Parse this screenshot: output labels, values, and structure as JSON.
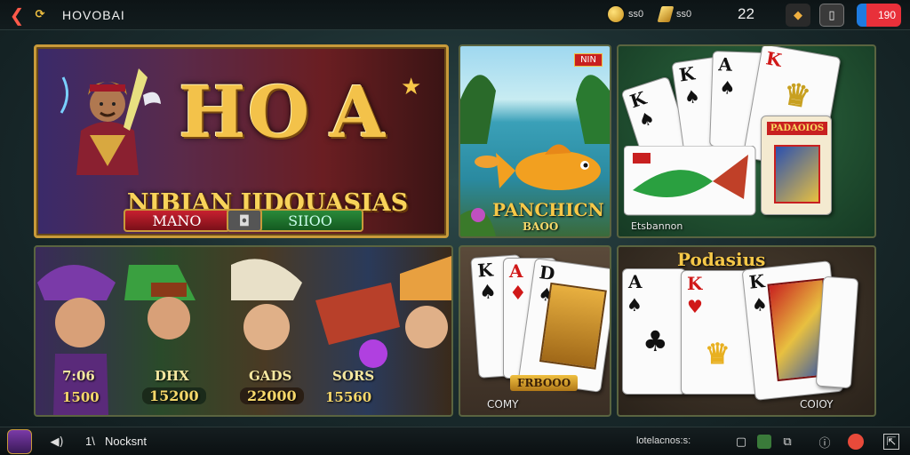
{
  "topbar": {
    "title": "HOVOBAI",
    "coins": "ss0",
    "gold": "ss0",
    "level": "22",
    "gem_value": "190"
  },
  "banner": {
    "title_left": "HO",
    "title_right": "A",
    "subtitle": "NIBIAN IIDOUASIAS",
    "button_left": "MANO",
    "button_right": "SIIOO"
  },
  "fish_game": {
    "badge": "NIN",
    "title": "PANCHICN",
    "sub": "BAOO"
  },
  "cards_game_1": {
    "banner": "PADAOIOS",
    "caption": "Etsbannon",
    "ranks": [
      "K",
      "K",
      "A",
      "K"
    ]
  },
  "slot_tiles": [
    {
      "name": "7:06",
      "value": "1500"
    },
    {
      "name": "DHX",
      "value": "15200"
    },
    {
      "name": "GADS",
      "value": "22000"
    },
    {
      "name": "SORS",
      "value": "15560"
    }
  ],
  "cards_game_2": {
    "ranks": [
      "K",
      "A",
      "D"
    ],
    "plate": "FRBOOO",
    "caption": "COMY"
  },
  "cards_game_3": {
    "title": "Podasius",
    "ranks": [
      "A",
      "K",
      "K"
    ],
    "caption": "COIOY"
  },
  "botbar": {
    "label_number": "1\\",
    "label": "Nocksnt",
    "right_text": "lotelacnos:s:"
  },
  "colors": {
    "accent_gold": "#c89a3a",
    "danger": "#e8303a",
    "brand_blue": "#1e7be0"
  }
}
